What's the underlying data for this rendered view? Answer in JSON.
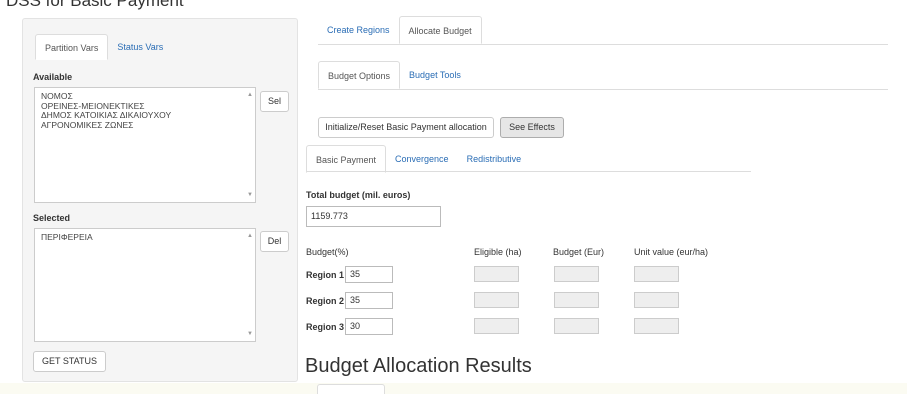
{
  "page_title": "DSS for Basic Payment",
  "left_panel": {
    "tabs": [
      {
        "label": "Partition Vars",
        "active": true
      },
      {
        "label": "Status Vars",
        "active": false
      }
    ],
    "available_label": "Available",
    "available_items": [
      "ΝΟΜΟΣ",
      "ΟΡΕΙΝΕΣ-ΜΕΙΟΝΕΚΤΙΚΕΣ",
      "ΔΗΜΟΣ ΚΑΤΟΙΚΙΑΣ ΔΙΚΑΙΟΥΧΟΥ",
      "ΑΓΡΟΝΟΜΙΚΕΣ ΖΩΝΕΣ"
    ],
    "sel_button": "Sel",
    "selected_label": "Selected",
    "selected_items": [
      "ΠΕΡΙΦΕΡΕΙΑ"
    ],
    "del_button": "Del",
    "get_status_button": "GET STATUS"
  },
  "main_tabs": [
    {
      "label": "Create Regions",
      "active": false
    },
    {
      "label": "Allocate Budget",
      "active": true
    }
  ],
  "sub_tabs": [
    {
      "label": "Budget Options",
      "active": true
    },
    {
      "label": "Budget Tools",
      "active": false
    }
  ],
  "actions": {
    "initialize_button": "Initialize/Reset Basic Payment allocation",
    "see_effects_button": "See Effects"
  },
  "payment_tabs": [
    {
      "label": "Basic Payment",
      "active": true
    },
    {
      "label": "Convergence",
      "active": false
    },
    {
      "label": "Redistributive",
      "active": false
    }
  ],
  "total_budget": {
    "label": "Total budget (mil. euros)",
    "value": "1159.773"
  },
  "table": {
    "headers": [
      "Budget(%)",
      "Eligible (ha)",
      "Budget (Eur)",
      "Unit value (eur/ha)"
    ],
    "rows": [
      {
        "label": "Region 1",
        "value": "35"
      },
      {
        "label": "Region 2",
        "value": "35"
      },
      {
        "label": "Region 3",
        "value": "30"
      }
    ]
  },
  "results_title": "Budget Allocation Results"
}
